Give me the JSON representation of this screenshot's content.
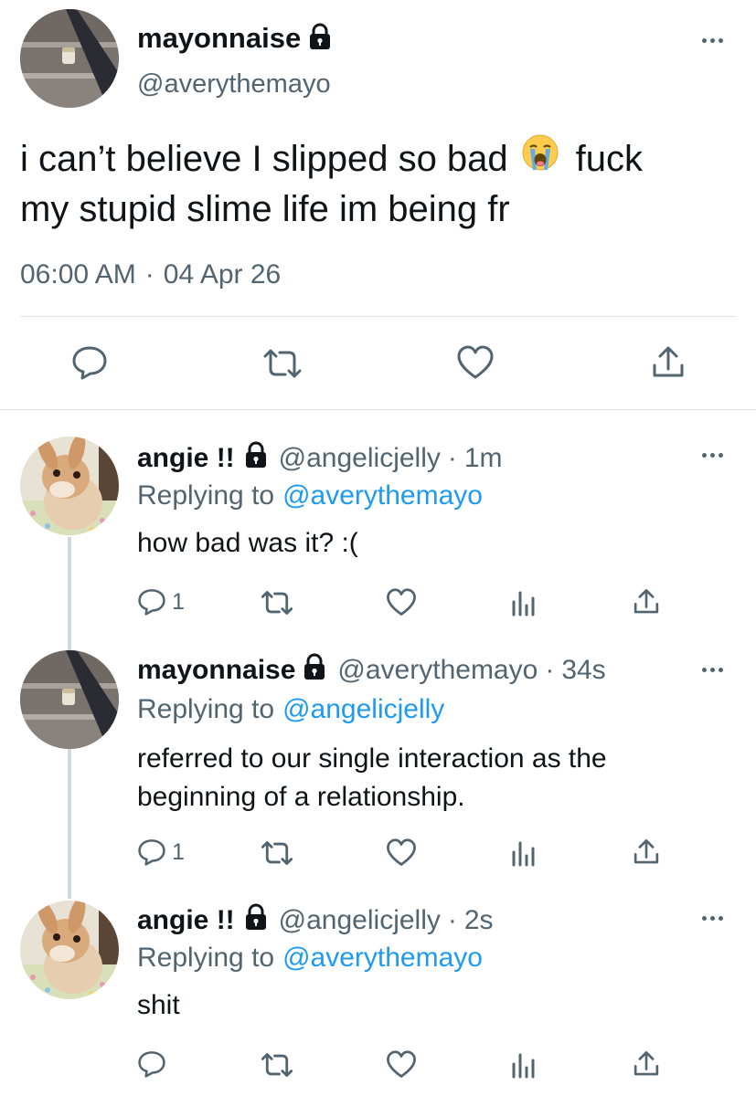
{
  "main_tweet": {
    "display_name": "mayonnaise",
    "handle": "@averythemayo",
    "text_line1": "i can’t believe I slipped so bad",
    "text_after_emoji": "fuck",
    "text_line2": "my stupid slime life im being fr",
    "emoji": "loudly-crying-face",
    "time": "06:00 AM",
    "separator": "·",
    "date": "04 Apr 26",
    "actions": [
      "reply-icon",
      "retweet-icon",
      "like-icon",
      "share-icon"
    ]
  },
  "replies": [
    {
      "display_name": "angie !!",
      "handle": "@angelicjelly",
      "separator": "·",
      "age": "1m",
      "replying_prefix": "Replying to",
      "replying_to": "@averythemayo",
      "text_lines": [
        "how bad was it? :("
      ],
      "reply_count": "1"
    },
    {
      "display_name": "mayonnaise",
      "handle": "@averythemayo",
      "separator": "·",
      "age": "34s",
      "replying_prefix": "Replying to",
      "replying_to": "@angelicjelly",
      "text_lines": [
        "referred to our single interaction as the",
        "beginning of a relationship."
      ],
      "reply_count": "1"
    },
    {
      "display_name": "angie !!",
      "handle": "@angelicjelly",
      "separator": "·",
      "age": "2s",
      "replying_prefix": "Replying to",
      "replying_to": "@averythemayo",
      "text_lines": [
        "shit"
      ],
      "reply_count": ""
    }
  ],
  "colors": {
    "text": "#0f1419",
    "muted": "#536471",
    "link": "#1d9bf0",
    "divider": "#dfe3e6",
    "thread_line": "#cfd9de"
  }
}
